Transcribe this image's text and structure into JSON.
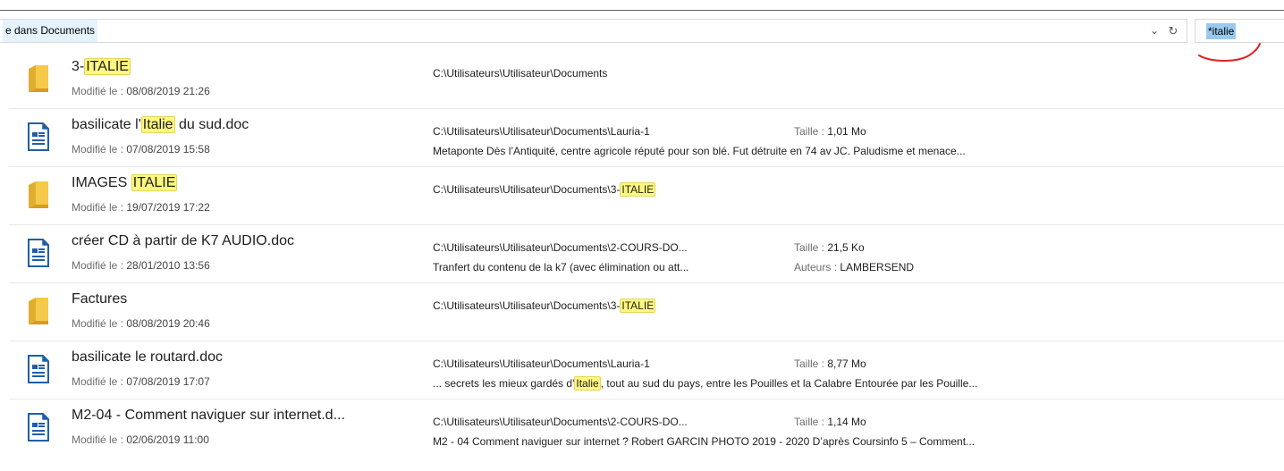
{
  "address_bar": {
    "text": "e dans Documents",
    "search_query": "*italie"
  },
  "labels": {
    "modified": "Modifié le : ",
    "size": "Taille : ",
    "authors": "Auteurs : "
  },
  "results": [
    {
      "type": "folder",
      "name_parts": [
        "3-",
        "ITALIE",
        ""
      ],
      "modified": "08/08/2019 21:26",
      "path_parts": [
        "C:\\Utilisateurs\\Utilisateur\\Documents",
        "",
        ""
      ],
      "size": "",
      "snippet_parts": [
        "",
        "",
        ""
      ],
      "author": ""
    },
    {
      "type": "document",
      "name_parts": [
        "basilicate l'",
        "Italie",
        " du sud.doc"
      ],
      "modified": "07/08/2019 15:58",
      "path_parts": [
        "C:\\Utilisateurs\\Utilisateur\\Documents\\Lauria-1",
        "",
        ""
      ],
      "size": "1,01 Mo",
      "snippet_parts": [
        "Metaponte Dès l’Antiquité, centre agricole réputé pour son blé. Fut détruite en 74 av JC. Paludisme et menace...",
        "",
        ""
      ],
      "author": ""
    },
    {
      "type": "folder",
      "name_parts": [
        "IMAGES ",
        "ITALIE",
        ""
      ],
      "modified": "19/07/2019 17:22",
      "path_parts": [
        "C:\\Utilisateurs\\Utilisateur\\Documents\\3-",
        "ITALIE",
        ""
      ],
      "size": "",
      "snippet_parts": [
        "",
        "",
        ""
      ],
      "author": ""
    },
    {
      "type": "document",
      "name_parts": [
        "créer CD à partir de K7 AUDIO.doc",
        "",
        ""
      ],
      "modified": "28/01/2010 13:56",
      "path_parts": [
        "C:\\Utilisateurs\\Utilisateur\\Documents\\2-COURS-DO...",
        "",
        ""
      ],
      "size": "21,5 Ko",
      "snippet_parts": [
        "Tranfert du contenu de la k7 (avec élimination ou att...",
        "",
        ""
      ],
      "author": "LAMBERSEND"
    },
    {
      "type": "folder",
      "name_parts": [
        "Factures",
        "",
        ""
      ],
      "modified": "08/08/2019 20:46",
      "path_parts": [
        "C:\\Utilisateurs\\Utilisateur\\Documents\\3-",
        "ITALIE",
        ""
      ],
      "size": "",
      "snippet_parts": [
        "",
        "",
        ""
      ],
      "author": ""
    },
    {
      "type": "document",
      "name_parts": [
        "basilicate le routard.doc",
        "",
        ""
      ],
      "modified": "07/08/2019 17:07",
      "path_parts": [
        "C:\\Utilisateurs\\Utilisateur\\Documents\\Lauria-1",
        "",
        ""
      ],
      "size": "8,77 Mo",
      "snippet_parts": [
        "... secrets les mieux gardés d'",
        "Italie",
        ", tout au sud du pays, entre les Pouilles et la Calabre Entourée par les Pouille..."
      ],
      "author": ""
    },
    {
      "type": "document",
      "name_parts": [
        "M2-04 - Comment naviguer sur internet.d...",
        "",
        ""
      ],
      "modified": "02/06/2019 11:00",
      "path_parts": [
        "C:\\Utilisateurs\\Utilisateur\\Documents\\2-COURS-DO...",
        "",
        ""
      ],
      "size": "1,14 Mo",
      "snippet_parts": [
        "M2 - 04 Comment naviguer sur internet ? Robert GARCIN PHOTO 2019 - 2020 D’après Coursinfo 5 – Comment...",
        "",
        ""
      ],
      "author": ""
    }
  ],
  "colors": {
    "highlight": "#fff87f",
    "selection": "#99c9ef",
    "folder": "#f5c94a",
    "doc_icon": "#1f5fa8",
    "annotation": "#e02020"
  }
}
